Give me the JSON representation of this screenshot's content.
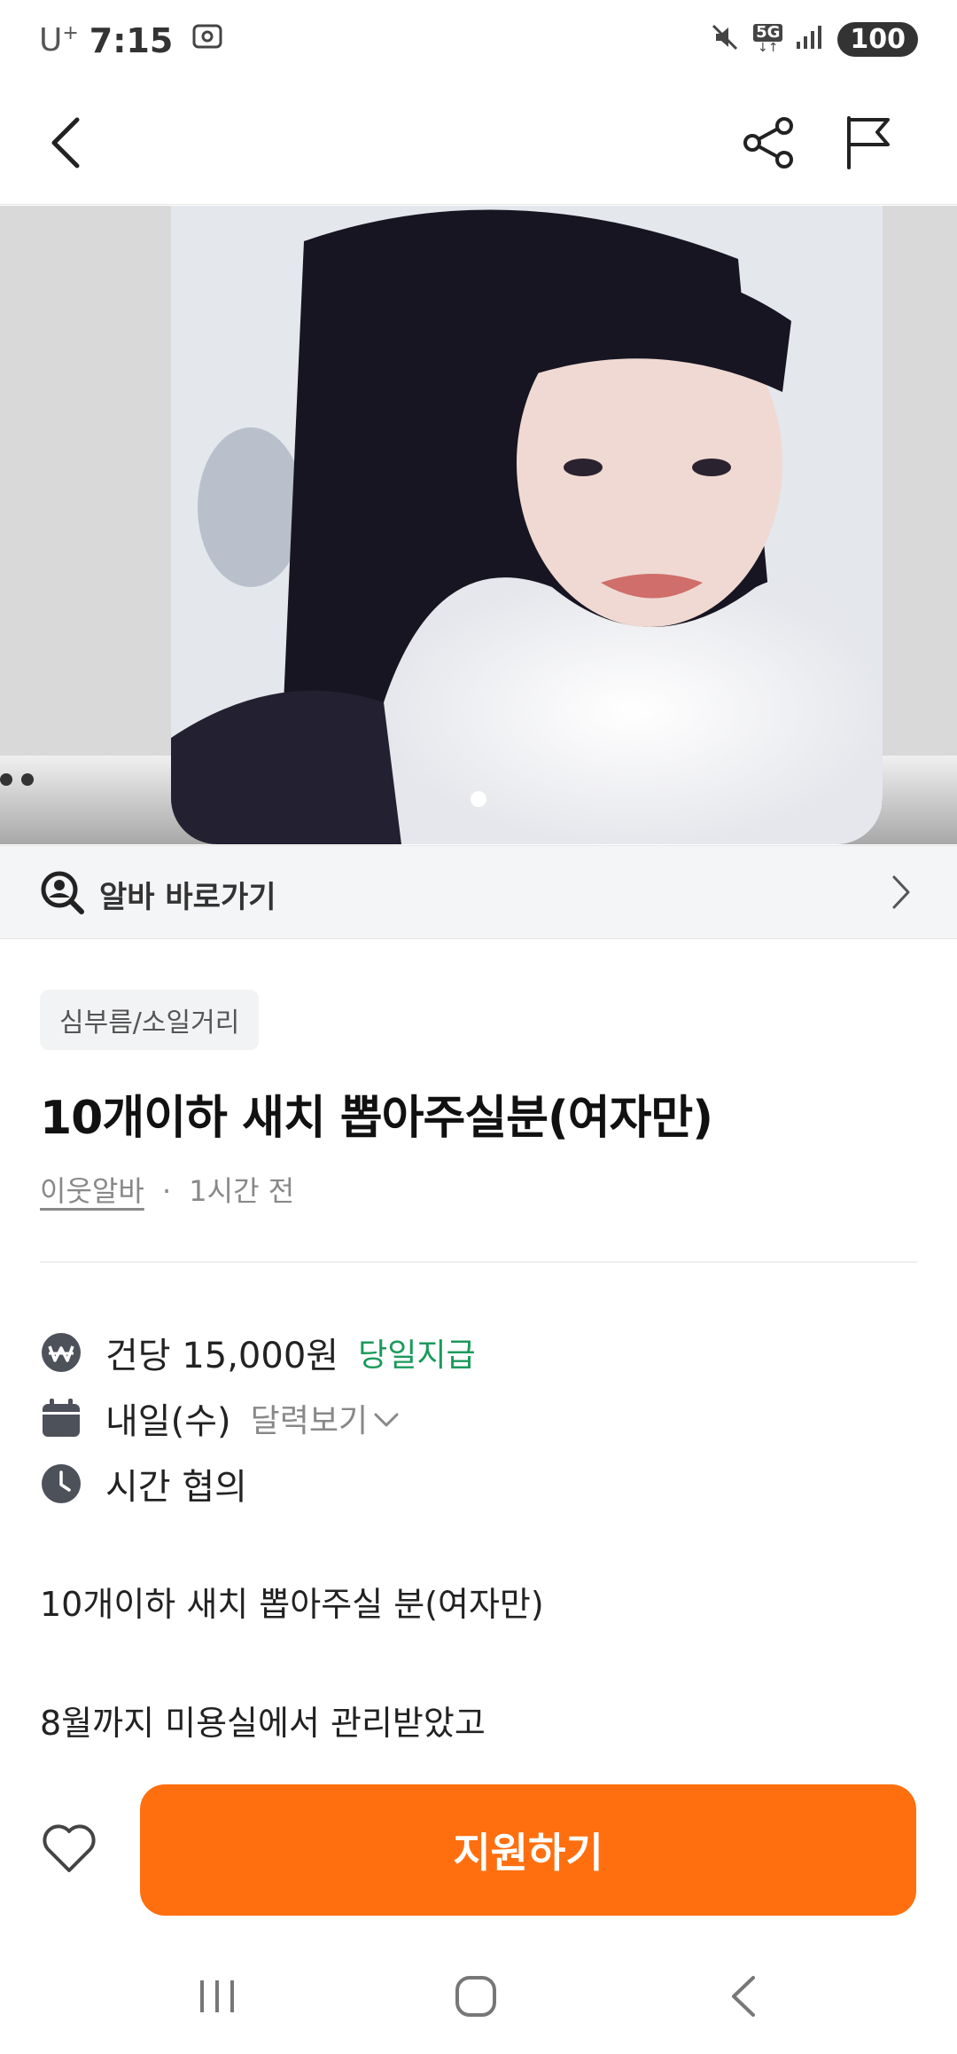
{
  "status_bar": {
    "carrier": "U",
    "carrier_sup": "+",
    "time": "7:15",
    "network": "5G",
    "battery": "100"
  },
  "gallery": {
    "image_alt": "photo",
    "current_index": 1
  },
  "shortcut": {
    "label": "알바 바로가기"
  },
  "post": {
    "category": "심부름/소일거리",
    "title": "10개이하 새치 뽑아주실분(여자만)",
    "author": "이웃알바",
    "separator": "·",
    "time_ago": "1시간 전"
  },
  "details": {
    "pay": "건당 15,000원",
    "pay_badge": "당일지급",
    "date": "내일(수)",
    "calendar_link": "달력보기",
    "time": "시간 협의"
  },
  "description": [
    "10개이하 새치 뽑아주실 분(여자만)",
    "8월까지 미용실에서 관리받았고"
  ],
  "actions": {
    "apply_label": "지원하기"
  },
  "colors": {
    "accent": "#ff6f0f",
    "pay_badge": "#1b9a5b"
  }
}
